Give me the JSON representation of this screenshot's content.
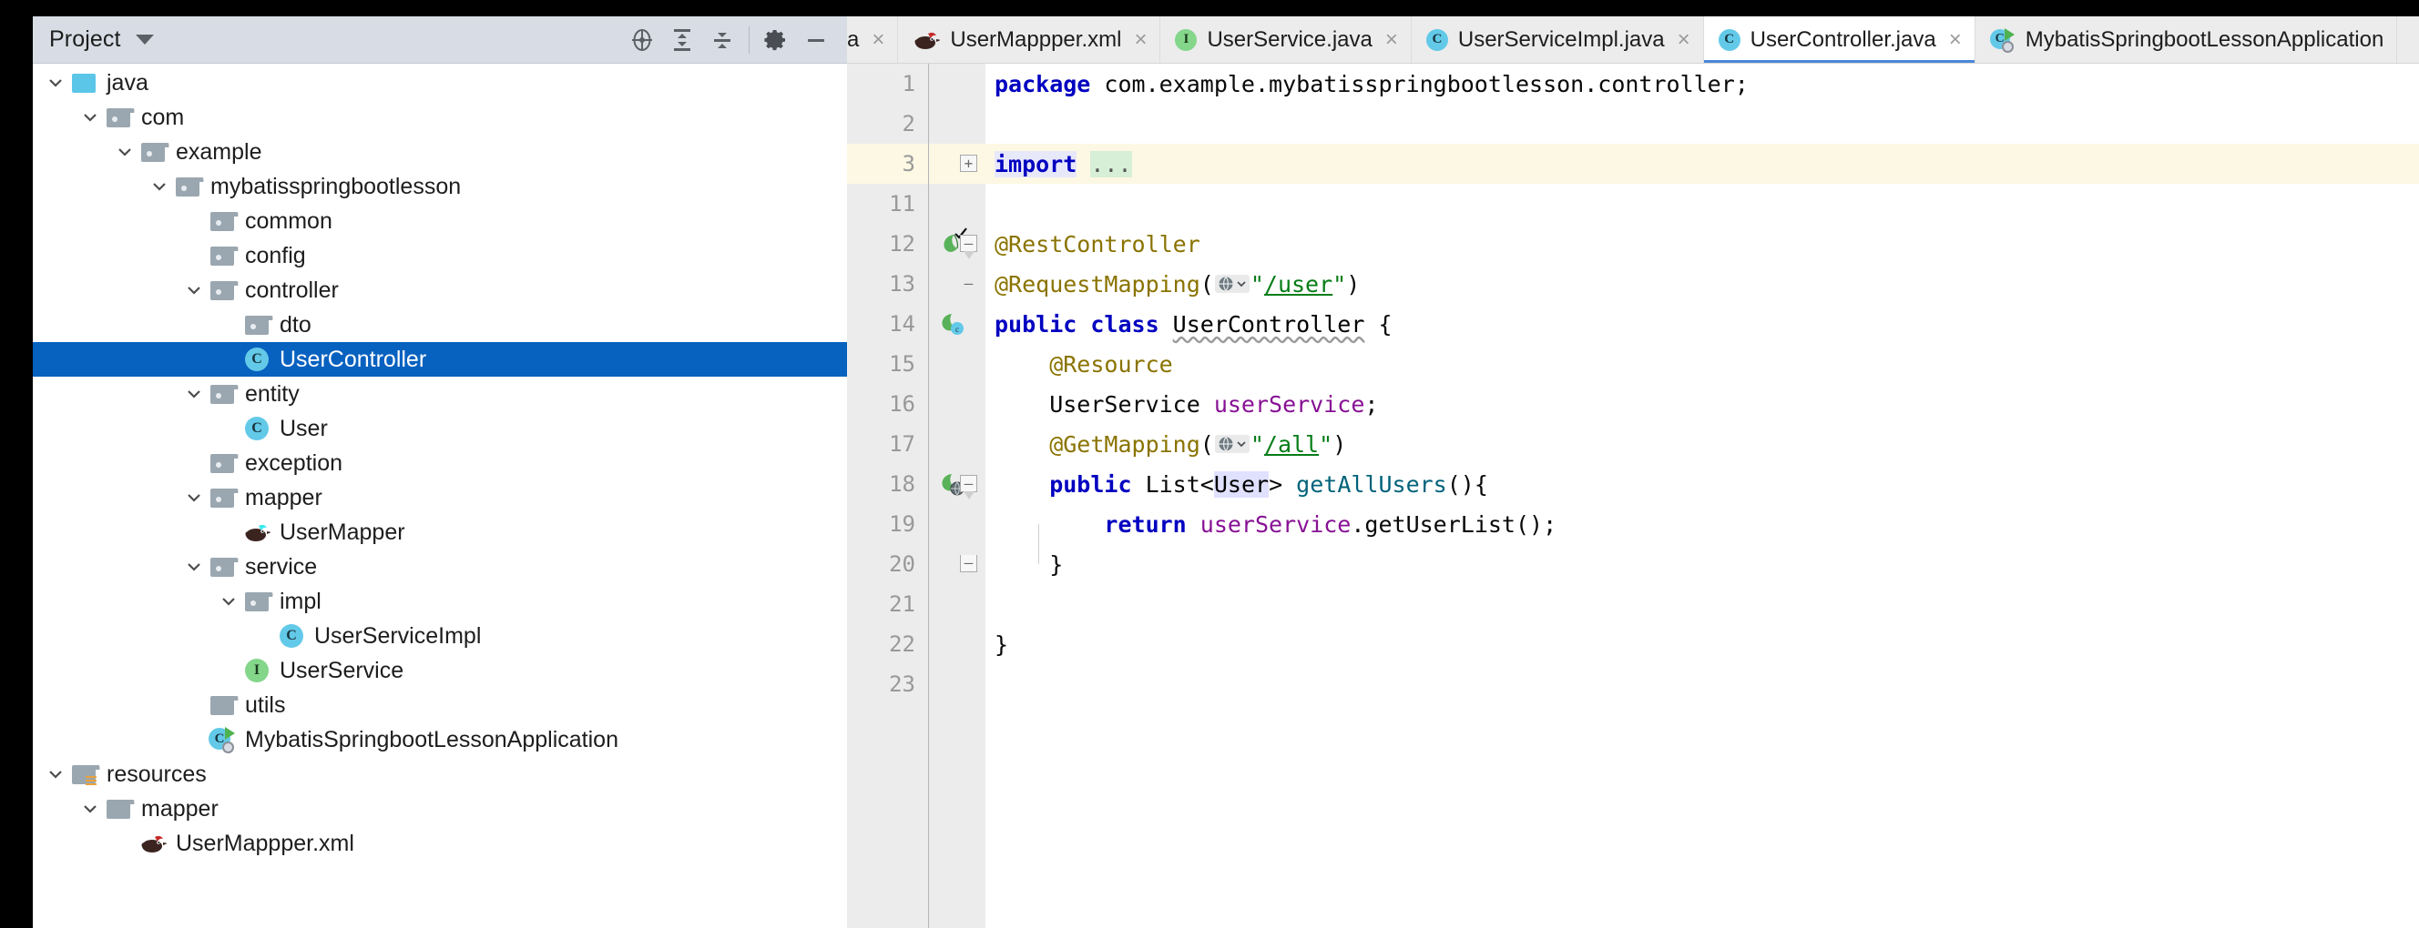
{
  "project_panel": {
    "title": "Project",
    "toolbar_icons": [
      {
        "name": "select-opened-file-icon",
        "glyph": "crosshair"
      },
      {
        "name": "expand-all-icon",
        "glyph": "expand"
      },
      {
        "name": "collapse-all-icon",
        "glyph": "collapse"
      },
      {
        "name": "settings-gear-icon",
        "glyph": "gear"
      },
      {
        "name": "hide-panel-icon",
        "glyph": "minus"
      }
    ],
    "tree": [
      {
        "label": "java",
        "indent": 2,
        "chevron": "down",
        "icon": "source-root",
        "selected": false
      },
      {
        "label": "com",
        "indent": 3,
        "chevron": "down",
        "icon": "folder",
        "selected": false
      },
      {
        "label": "example",
        "indent": 4,
        "chevron": "down",
        "icon": "folder",
        "selected": false
      },
      {
        "label": "mybatisspringbootlesson",
        "indent": 5,
        "chevron": "down",
        "icon": "folder",
        "selected": false
      },
      {
        "label": "common",
        "indent": 6,
        "chevron": "none",
        "icon": "folder",
        "selected": false
      },
      {
        "label": "config",
        "indent": 6,
        "chevron": "none",
        "icon": "folder",
        "selected": false
      },
      {
        "label": "controller",
        "indent": 6,
        "chevron": "down",
        "icon": "folder",
        "selected": false
      },
      {
        "label": "dto",
        "indent": 7,
        "chevron": "none",
        "icon": "folder",
        "selected": false
      },
      {
        "label": "UserController",
        "indent": 7,
        "chevron": "none",
        "icon": "class",
        "selected": true
      },
      {
        "label": "entity",
        "indent": 6,
        "chevron": "down",
        "icon": "folder",
        "selected": false
      },
      {
        "label": "User",
        "indent": 7,
        "chevron": "none",
        "icon": "class",
        "selected": false
      },
      {
        "label": "exception",
        "indent": 6,
        "chevron": "none",
        "icon": "folder",
        "selected": false
      },
      {
        "label": "mapper",
        "indent": 6,
        "chevron": "down",
        "icon": "folder",
        "selected": false
      },
      {
        "label": "UserMapper",
        "indent": 7,
        "chevron": "none",
        "icon": "mybatis-bird-dark",
        "selected": false
      },
      {
        "label": "service",
        "indent": 6,
        "chevron": "down",
        "icon": "folder",
        "selected": false
      },
      {
        "label": "impl",
        "indent": 7,
        "chevron": "down",
        "icon": "folder",
        "selected": false
      },
      {
        "label": "UserServiceImpl",
        "indent": 8,
        "chevron": "none",
        "icon": "class",
        "selected": false
      },
      {
        "label": "UserService",
        "indent": 7,
        "chevron": "none",
        "icon": "interface",
        "selected": false
      },
      {
        "label": "utils",
        "indent": 6,
        "chevron": "none",
        "icon": "folder-plain",
        "selected": false
      },
      {
        "label": "MybatisSpringbootLessonApplication",
        "indent": 6,
        "chevron": "none",
        "icon": "spring-app",
        "selected": false
      },
      {
        "label": "resources",
        "indent": 2,
        "chevron": "down",
        "icon": "resources-folder",
        "selected": false
      },
      {
        "label": "mapper",
        "indent": 3,
        "chevron": "down",
        "icon": "folder-plain",
        "selected": false
      },
      {
        "label": "UserMappper.xml",
        "indent": 4,
        "chevron": "none",
        "icon": "mybatis-bird-red",
        "selected": false
      }
    ]
  },
  "editor": {
    "tabs": [
      {
        "label": "a",
        "icon": "none",
        "active": false,
        "partial": true,
        "close": "×"
      },
      {
        "label": "UserMappper.xml",
        "icon": "mybatis-bird-red",
        "active": false,
        "partial": false,
        "close": "×"
      },
      {
        "label": "UserService.java",
        "icon": "interface",
        "active": false,
        "partial": false,
        "close": "×"
      },
      {
        "label": "UserServiceImpl.java",
        "icon": "class",
        "active": false,
        "partial": false,
        "close": "×"
      },
      {
        "label": "UserController.java",
        "icon": "class",
        "active": true,
        "partial": false,
        "close": "×"
      },
      {
        "label": "MybatisSpringbootLessonApplication",
        "icon": "spring-app",
        "active": false,
        "partial": false,
        "close": ""
      }
    ],
    "line_numbers": [
      "1",
      "2",
      "3",
      "11",
      "12",
      "13",
      "14",
      "15",
      "16",
      "17",
      "18",
      "19",
      "20",
      "21",
      "22",
      "23"
    ],
    "code_lines": [
      {
        "n": "1",
        "highlight": false,
        "tokens": [
          {
            "t": "package ",
            "c": "kw"
          },
          {
            "t": "com.example.mybatisspringbootlesson.controller;",
            "c": "plain"
          }
        ]
      },
      {
        "n": "2",
        "highlight": false,
        "tokens": []
      },
      {
        "n": "3",
        "highlight": true,
        "tokens": [
          {
            "t": "import",
            "c": "import-kw"
          },
          {
            "t": " ",
            "c": "plain"
          },
          {
            "t": "...",
            "c": "import-dots"
          }
        ]
      },
      {
        "n": "11",
        "highlight": false,
        "tokens": []
      },
      {
        "n": "12",
        "highlight": false,
        "tokens": [
          {
            "t": "@RestController",
            "c": "anno"
          }
        ]
      },
      {
        "n": "13",
        "highlight": false,
        "tokens": [
          {
            "t": "@RequestMapping",
            "c": "anno"
          },
          {
            "t": "(",
            "c": "plain"
          },
          {
            "t": "GLOBE",
            "c": "globe"
          },
          {
            "t": "\"",
            "c": "str"
          },
          {
            "t": "/user",
            "c": "strlink"
          },
          {
            "t": "\"",
            "c": "str"
          },
          {
            "t": ")",
            "c": "plain"
          }
        ]
      },
      {
        "n": "14",
        "highlight": false,
        "tokens": [
          {
            "t": "public ",
            "c": "kw"
          },
          {
            "t": "class ",
            "c": "kw"
          },
          {
            "t": "UserController",
            "c": "squiggle"
          },
          {
            "t": " {",
            "c": "plain"
          }
        ]
      },
      {
        "n": "15",
        "highlight": false,
        "tokens": [
          {
            "t": "    @Resource",
            "c": "anno"
          }
        ]
      },
      {
        "n": "16",
        "highlight": false,
        "tokens": [
          {
            "t": "    UserService ",
            "c": "plain"
          },
          {
            "t": "userService",
            "c": "fld"
          },
          {
            "t": ";",
            "c": "plain"
          }
        ]
      },
      {
        "n": "17",
        "highlight": false,
        "tokens": [
          {
            "t": "    @GetMapping",
            "c": "anno"
          },
          {
            "t": "(",
            "c": "plain"
          },
          {
            "t": "GLOBE",
            "c": "globe"
          },
          {
            "t": "\"",
            "c": "str"
          },
          {
            "t": "/all",
            "c": "strlink"
          },
          {
            "t": "\"",
            "c": "str"
          },
          {
            "t": ")",
            "c": "plain"
          }
        ]
      },
      {
        "n": "18",
        "highlight": false,
        "tokens": [
          {
            "t": "    public ",
            "c": "kw"
          },
          {
            "t": "List<",
            "c": "plain"
          },
          {
            "t": "User",
            "c": "sel-tok"
          },
          {
            "t": "> ",
            "c": "plain"
          },
          {
            "t": "getAllUsers",
            "c": "mth"
          },
          {
            "t": "(){",
            "c": "plain"
          }
        ]
      },
      {
        "n": "19",
        "highlight": false,
        "tokens": [
          {
            "t": "        return ",
            "c": "kw"
          },
          {
            "t": "userService",
            "c": "fld"
          },
          {
            "t": ".getUserList();",
            "c": "plain"
          }
        ]
      },
      {
        "n": "20",
        "highlight": false,
        "tokens": [
          {
            "t": "    }",
            "c": "plain"
          }
        ]
      },
      {
        "n": "21",
        "highlight": false,
        "tokens": []
      },
      {
        "n": "22",
        "highlight": false,
        "tokens": [
          {
            "t": "}",
            "c": "plain"
          }
        ]
      },
      {
        "n": "23",
        "highlight": false,
        "tokens": []
      }
    ]
  },
  "colors": {
    "selection_blue": "#0761bf",
    "toolbar_bg": "#d8dde5",
    "tab_bg": "#ececec",
    "gutter_bg": "#ececec",
    "highlight_line": "#fdf8e3",
    "keyword": "#0000c0",
    "annotation": "#8a7300",
    "string": "#067d17",
    "field": "#871094",
    "method": "#00627a",
    "class_icon": "#63c9e8",
    "interface_icon": "#84d68a"
  }
}
